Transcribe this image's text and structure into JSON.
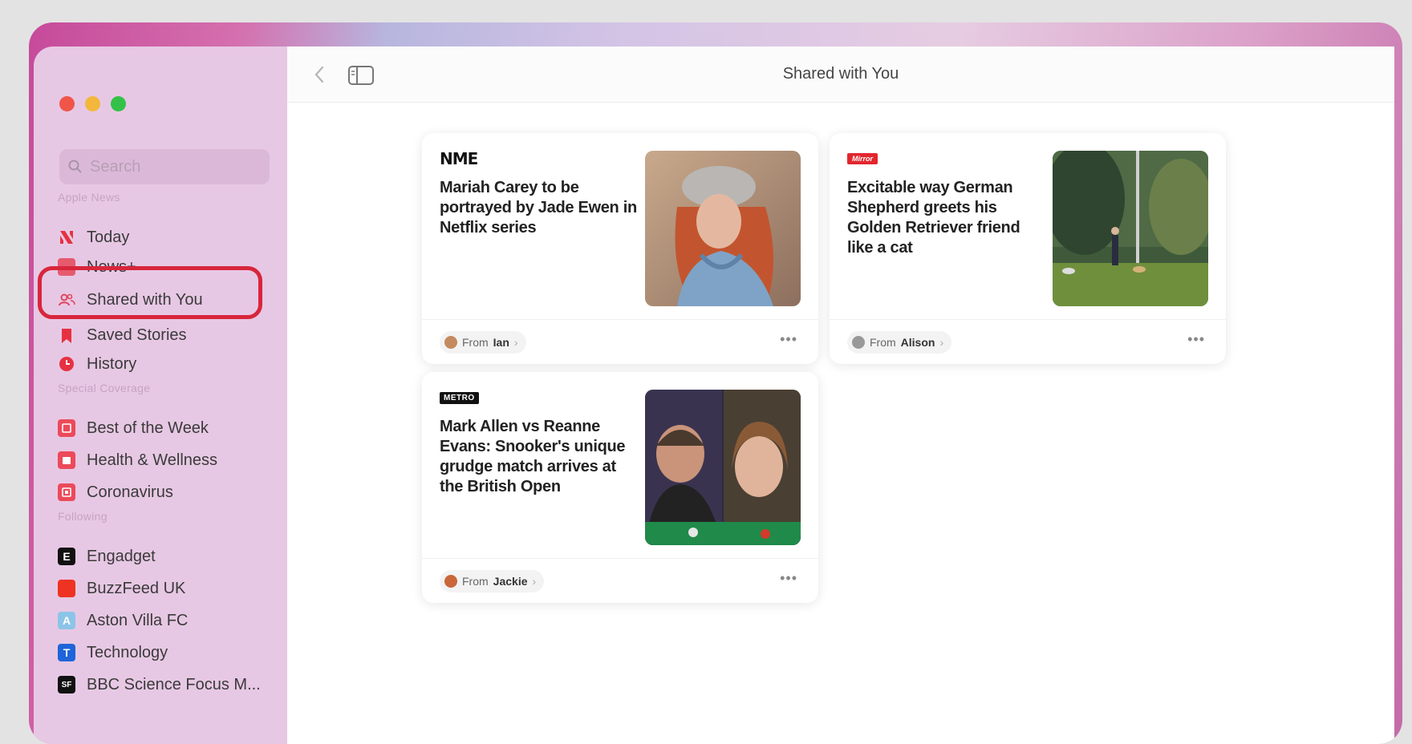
{
  "window": {
    "title": "Shared with You"
  },
  "sidebar": {
    "search_placeholder": "Search",
    "sections": {
      "apple_news": "Apple News",
      "special_coverage": "Special Coverage",
      "following": "Following"
    },
    "apple_news_items": [
      {
        "label": "Today",
        "icon": "apple-news-icon"
      },
      {
        "label": "News+",
        "icon": "news-plus-icon"
      },
      {
        "label": "Shared with You",
        "icon": "shared-people-icon",
        "selected": true
      },
      {
        "label": "Saved Stories",
        "icon": "bookmark-icon"
      },
      {
        "label": "History",
        "icon": "clock-icon"
      }
    ],
    "special_coverage_items": [
      {
        "label": "Best of the Week",
        "icon": "best-of-week-icon"
      },
      {
        "label": "Health & Wellness",
        "icon": "health-icon"
      },
      {
        "label": "Coronavirus",
        "icon": "coronavirus-icon"
      }
    ],
    "following_items": [
      {
        "label": "Engadget",
        "icon_letter": "E",
        "color": "#111111"
      },
      {
        "label": "BuzzFeed UK",
        "icon_letter": "",
        "color": "#ee3322"
      },
      {
        "label": "Aston Villa FC",
        "icon_letter": "A",
        "color": "#8cc4e8"
      },
      {
        "label": "Technology",
        "icon_letter": "T",
        "color": "#1f64d8"
      },
      {
        "label": "BBC Science Focus M...",
        "icon_letter": "SF",
        "color": "#111111"
      }
    ]
  },
  "toolbar": {
    "title": "Shared with You"
  },
  "stories": [
    {
      "publisher": "NME",
      "headline": "Mariah Carey to be portrayed by Jade Ewen in Netflix series",
      "from_prefix": "From",
      "from_name": "Ian",
      "more": "•••"
    },
    {
      "publisher": "Mirror",
      "headline": "Excitable way German Shepherd greets his Golden Retriever friend like a cat",
      "from_prefix": "From",
      "from_name": "Alison",
      "more": "•••"
    },
    {
      "publisher": "METRO",
      "headline": "Mark Allen vs Reanne Evans: Snooker's unique grudge match arrives at the British Open",
      "from_prefix": "From",
      "from_name": "Jackie",
      "more": "•••"
    }
  ],
  "colors": {
    "accent_red": "#d8263b",
    "sidebar_bg": "#e7c8e4",
    "selected_bg": "#d3a9d0"
  }
}
